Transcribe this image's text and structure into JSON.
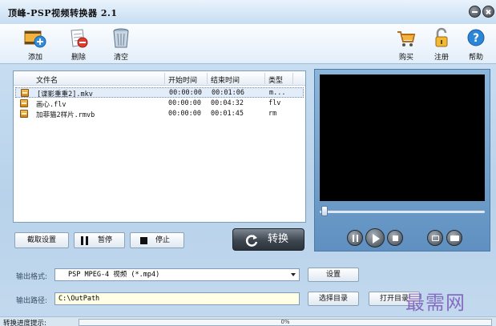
{
  "window": {
    "title": "顶峰-PSP视频转换器 2.1",
    "controls": [
      "minimize",
      "close"
    ]
  },
  "toolbar": {
    "add_label": "添加",
    "delete_label": "删除",
    "clear_label": "清空",
    "buy_label": "购买",
    "register_label": "注册",
    "help_label": "帮助"
  },
  "file_list": {
    "columns": [
      "文件名",
      "开始时间",
      "结束时间",
      "类型"
    ],
    "rows": [
      {
        "name": "[谍影重重2].mkv",
        "start": "00:00:00",
        "end": "00:01:06",
        "type": "m...",
        "selected": true
      },
      {
        "name": "画心.flv",
        "start": "00:00:00",
        "end": "00:04:32",
        "type": "flv",
        "selected": false
      },
      {
        "name": "加菲猫2样片.rmvb",
        "start": "00:00:00",
        "end": "00:01:45",
        "type": "rm",
        "selected": false
      }
    ]
  },
  "controls": {
    "capture_label": "截取设置",
    "pause_label": "暂停",
    "stop_label": "停止",
    "convert_label": "转换"
  },
  "player": {
    "seek_fraction": 0.02,
    "buttons": [
      "pause",
      "play",
      "stop",
      "snapshot",
      "folder"
    ]
  },
  "output": {
    "format_label": "输出格式:",
    "format_value": "PSP MPEG-4 视频 (*.mp4)",
    "settings_label": "设置",
    "path_label": "输出路径:",
    "path_value": "C:\\OutPath",
    "choose_dir_label": "选择目录",
    "open_dir_label": "打开目录"
  },
  "status": {
    "progress_label": "转换进度提示:",
    "progress_text": "0%",
    "progress_fraction": 0
  },
  "watermark": "最需网",
  "colors": {
    "accent": "#5b94cf",
    "panel": "#bcd4ea",
    "video_bg": "#000000"
  }
}
